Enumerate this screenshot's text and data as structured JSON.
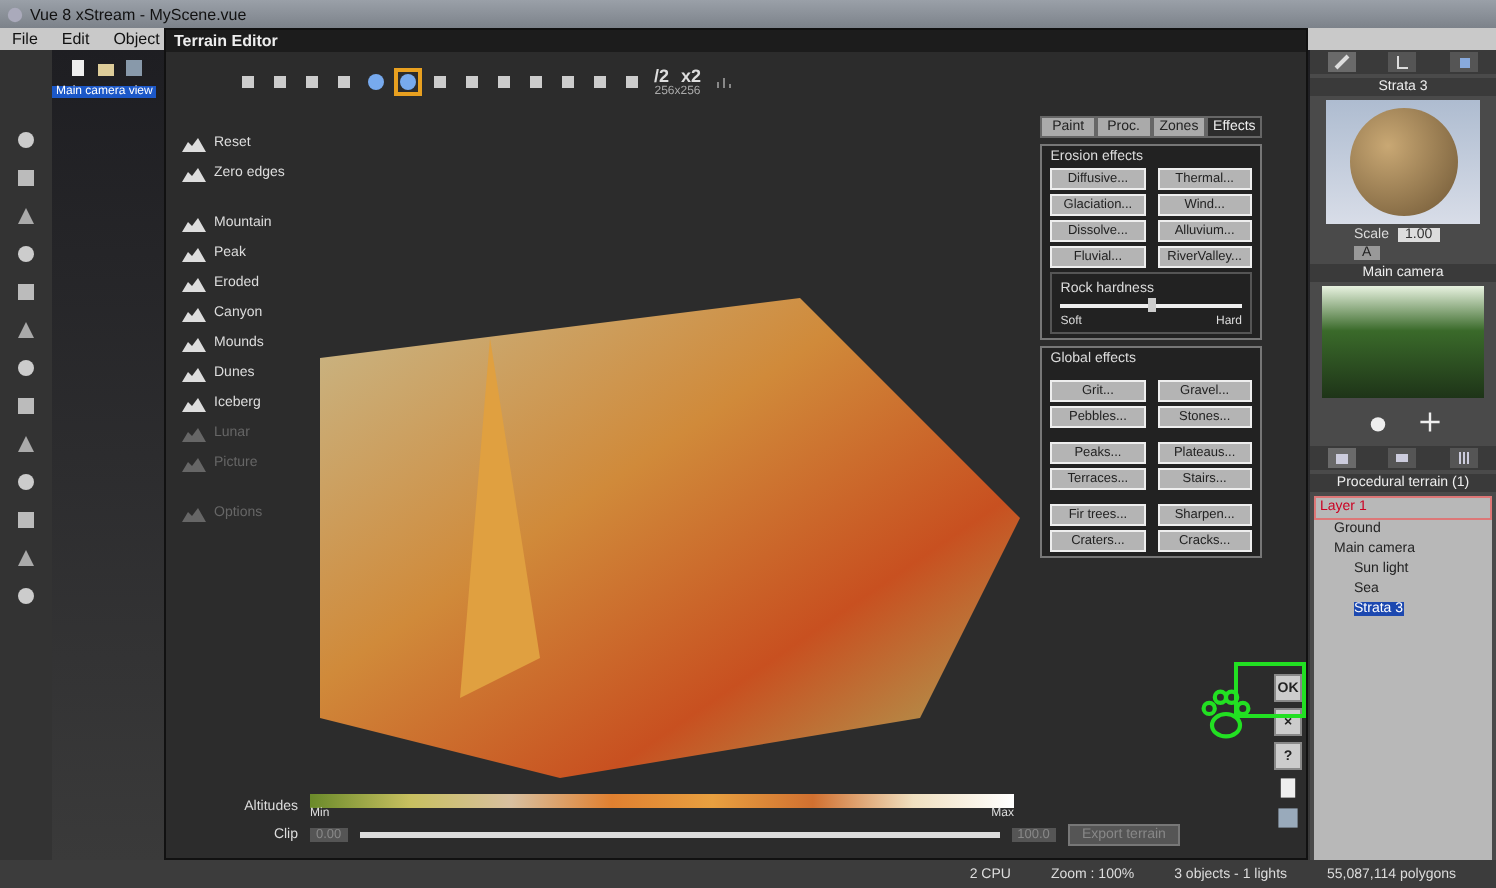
{
  "app": {
    "title": "Vue 8 xStream - MyScene.vue",
    "menu": [
      "File",
      "Edit",
      "Object"
    ]
  },
  "viewport": {
    "label": "Main camera view"
  },
  "editor": {
    "title": "Terrain Editor",
    "half_label": "/2",
    "double_label": "x2",
    "resolution": "256x256",
    "command_groups": [
      [
        {
          "label": "Reset",
          "disabled": false
        },
        {
          "label": "Zero edges",
          "disabled": false
        }
      ],
      [
        {
          "label": "Mountain",
          "disabled": false
        },
        {
          "label": "Peak",
          "disabled": false
        },
        {
          "label": "Eroded",
          "disabled": false
        },
        {
          "label": "Canyon",
          "disabled": false
        },
        {
          "label": "Mounds",
          "disabled": false
        },
        {
          "label": "Dunes",
          "disabled": false
        },
        {
          "label": "Iceberg",
          "disabled": false
        },
        {
          "label": "Lunar",
          "disabled": true
        },
        {
          "label": "Picture",
          "disabled": true
        }
      ],
      [
        {
          "label": "Options",
          "disabled": true
        }
      ]
    ],
    "tabs": [
      {
        "label": "Paint",
        "selected": false
      },
      {
        "label": "Proc.",
        "selected": false
      },
      {
        "label": "Zones",
        "selected": false
      },
      {
        "label": "Effects",
        "selected": true
      }
    ],
    "erosion": {
      "title": "Erosion effects",
      "buttons": [
        "Diffusive...",
        "Thermal...",
        "Glaciation...",
        "Wind...",
        "Dissolve...",
        "Alluvium...",
        "Fluvial...",
        "RiverValley..."
      ]
    },
    "rock_hardness": {
      "title": "Rock hardness",
      "min_label": "Soft",
      "max_label": "Hard",
      "level": 0.5
    },
    "global": {
      "title": "Global effects",
      "groups": [
        [
          "Grit...",
          "Gravel...",
          "Pebbles...",
          "Stones..."
        ],
        [
          "Peaks...",
          "Plateaus...",
          "Terraces...",
          "Stairs..."
        ],
        [
          "Fir trees...",
          "Sharpen...",
          "Craters...",
          "Cracks..."
        ]
      ]
    },
    "altitudes": {
      "label": "Altitudes",
      "min_label": "Min",
      "max_label": "Max"
    },
    "clip": {
      "label": "Clip",
      "low": "0.00",
      "high": "100.0",
      "level": 1
    },
    "export_button": "Export terrain",
    "side_buttons": [
      "OK",
      "×",
      "?"
    ]
  },
  "sidebar": {
    "material": {
      "title": "Strata 3",
      "scale_label": "Scale",
      "scale_value": "1.00",
      "mode": "A"
    },
    "camera": {
      "title": "Main camera"
    },
    "tree": {
      "title": "Procedural terrain (1)",
      "items": [
        {
          "label": "Layer 1",
          "selected": false,
          "children": [
            {
              "label": "Ground",
              "selected": false
            },
            {
              "label": "Main camera",
              "selected": false,
              "children": [
                {
                  "label": "Sun light",
                  "selected": false
                },
                {
                  "label": "Sea",
                  "selected": false
                },
                {
                  "label": "Strata 3",
                  "selected": true
                }
              ]
            }
          ]
        }
      ]
    }
  },
  "status": [
    "2 CPU",
    "Zoom : 100%",
    "3 objects - 1 lights",
    "55,087,114 polygons"
  ]
}
